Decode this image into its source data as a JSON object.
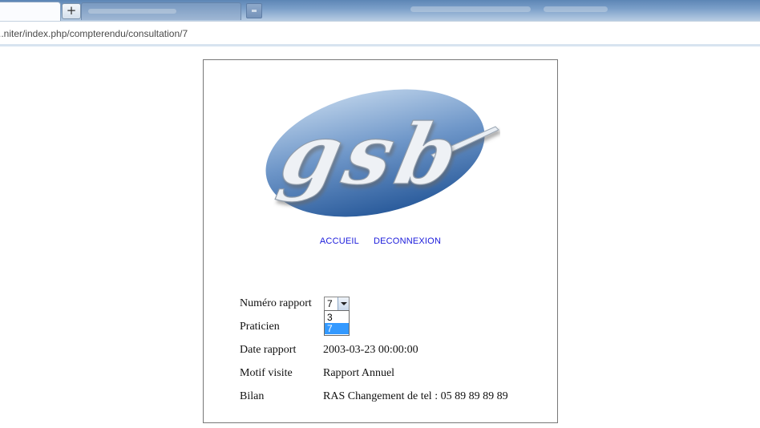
{
  "browser": {
    "url": "..niter/index.php/compterendu/consultation/7",
    "new_tab_symbol": "+"
  },
  "nav": {
    "accueil": "ACCUEIL",
    "deconnexion": "DECONNEXION"
  },
  "logo": {
    "text": "gsb",
    "colors": {
      "oval_light": "#a9c3e2",
      "oval_dark": "#2e5e9e"
    }
  },
  "form": {
    "numero_label": "Numéro rapport",
    "numero_value": "7",
    "numero_options": [
      "3",
      "7"
    ],
    "praticien_label": "Praticien",
    "date_label": "Date rapport",
    "date_value": "2003-03-23 00:00:00",
    "motif_label": "Motif visite",
    "motif_value": "Rapport Annuel",
    "bilan_label": "Bilan",
    "bilan_value": "RAS Changement de tel : 05 89 89 89 89"
  },
  "colors": {
    "link": "#1a1adb",
    "option_highlight": "#3399ff"
  }
}
